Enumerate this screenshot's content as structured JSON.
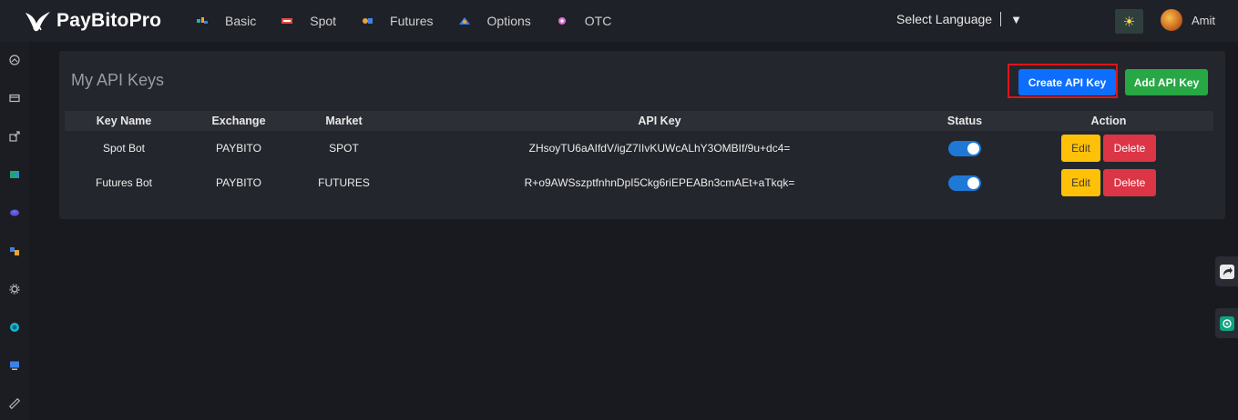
{
  "brand": {
    "name": "PayBitoPro"
  },
  "nav": {
    "items": [
      {
        "label": "Basic",
        "icon": "basic-icon",
        "color": "#22b3a6"
      },
      {
        "label": "Spot",
        "icon": "spot-icon",
        "color": "#e04a3f"
      },
      {
        "label": "Futures",
        "icon": "futures-icon",
        "color": "#e9a23b"
      },
      {
        "label": "Options",
        "icon": "options-icon",
        "color": "#3b82e6"
      },
      {
        "label": "OTC",
        "icon": "otc-icon",
        "color": "#d96fd1"
      }
    ]
  },
  "language": {
    "label": "Select Language",
    "caret": "▼"
  },
  "theme_toggle": {
    "icon": "sun-icon",
    "glyph": "☀"
  },
  "user": {
    "name": "Amit"
  },
  "page": {
    "title": "My API Keys",
    "create_label": "Create API Key",
    "add_label": "Add API Key"
  },
  "table": {
    "columns": [
      "Key Name",
      "Exchange",
      "Market",
      "API Key",
      "Status",
      "Action"
    ],
    "rows": [
      {
        "name": "Spot Bot",
        "exchange": "PAYBITO",
        "market": "SPOT",
        "api_key": "ZHsoyTU6aAIfdV/igZ7IIvKUWcALhY3OMBIf/9u+dc4=",
        "status_on": true,
        "edit": "Edit",
        "delete": "Delete"
      },
      {
        "name": "Futures Bot",
        "exchange": "PAYBITO",
        "market": "FUTURES",
        "api_key": "R+o9AWSszptfnhnDpI5Ckg6riEPEABn3cmAEt+aTkqk=",
        "status_on": true,
        "edit": "Edit",
        "delete": "Delete"
      }
    ]
  },
  "colors": {
    "primary": "#0d6efd",
    "success": "#28a745",
    "warning": "#ffc107",
    "danger": "#dc3545",
    "highlight": "#e0131b"
  }
}
